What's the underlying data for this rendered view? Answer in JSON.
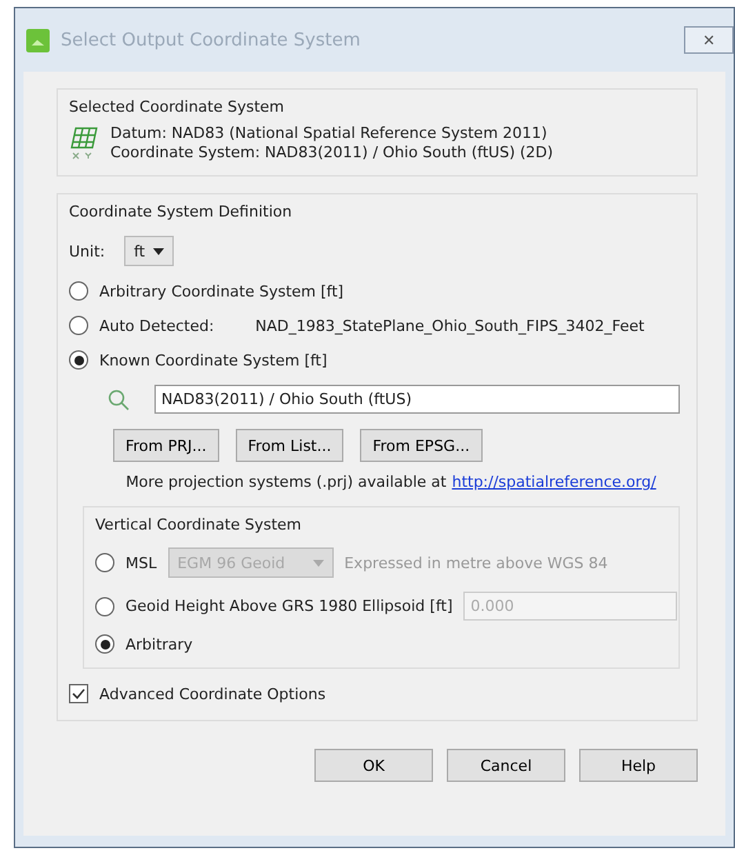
{
  "window": {
    "title": "Select Output Coordinate System",
    "close": "✕"
  },
  "selected_system": {
    "title": "Selected Coordinate System",
    "lines": [
      "Datum: NAD83 (National Spatial Reference System 2011)",
      "Coordinate System: NAD83(2011) / Ohio South (ftUS) (2D)"
    ]
  },
  "definition": {
    "title": "Coordinate System Definition",
    "unit_label": "Unit:",
    "unit_value": "ft",
    "options": [
      {
        "kind": "plain",
        "label": "Arbitrary Coordinate System [ft]",
        "selected": false
      },
      {
        "kind": "detected",
        "label": "Auto Detected:",
        "detail": "NAD_1983_StatePlane_Ohio_South_FIPS_3402_Feet",
        "selected": false
      },
      {
        "kind": "plain",
        "label": "Known Coordinate System [ft]",
        "selected": true
      }
    ],
    "search_value": "NAD83(2011) / Ohio South (ftUS)",
    "buttons": [
      "From PRJ...",
      "From List...",
      "From EPSG..."
    ],
    "info_text": "More projection systems (.prj) available at",
    "info_link": "http://spatialreference.org/",
    "vertical": {
      "title": "Vertical Coordinate System",
      "options": [
        {
          "kind": "dropdown",
          "label": "MSL",
          "value": "EGM 96 Geoid",
          "note": "Expressed in metre above WGS 84",
          "disabled": true,
          "selected": false
        },
        {
          "kind": "field",
          "label": "Geoid Height Above GRS 1980 Ellipsoid [ft]",
          "value": "0.000",
          "disabled": true,
          "selected": false
        },
        {
          "kind": "plain",
          "label": "Arbitrary",
          "selected": true
        }
      ]
    },
    "advanced": {
      "label": "Advanced Coordinate Options",
      "checked": true
    }
  },
  "buttons": [
    "OK",
    "Cancel",
    "Help"
  ]
}
